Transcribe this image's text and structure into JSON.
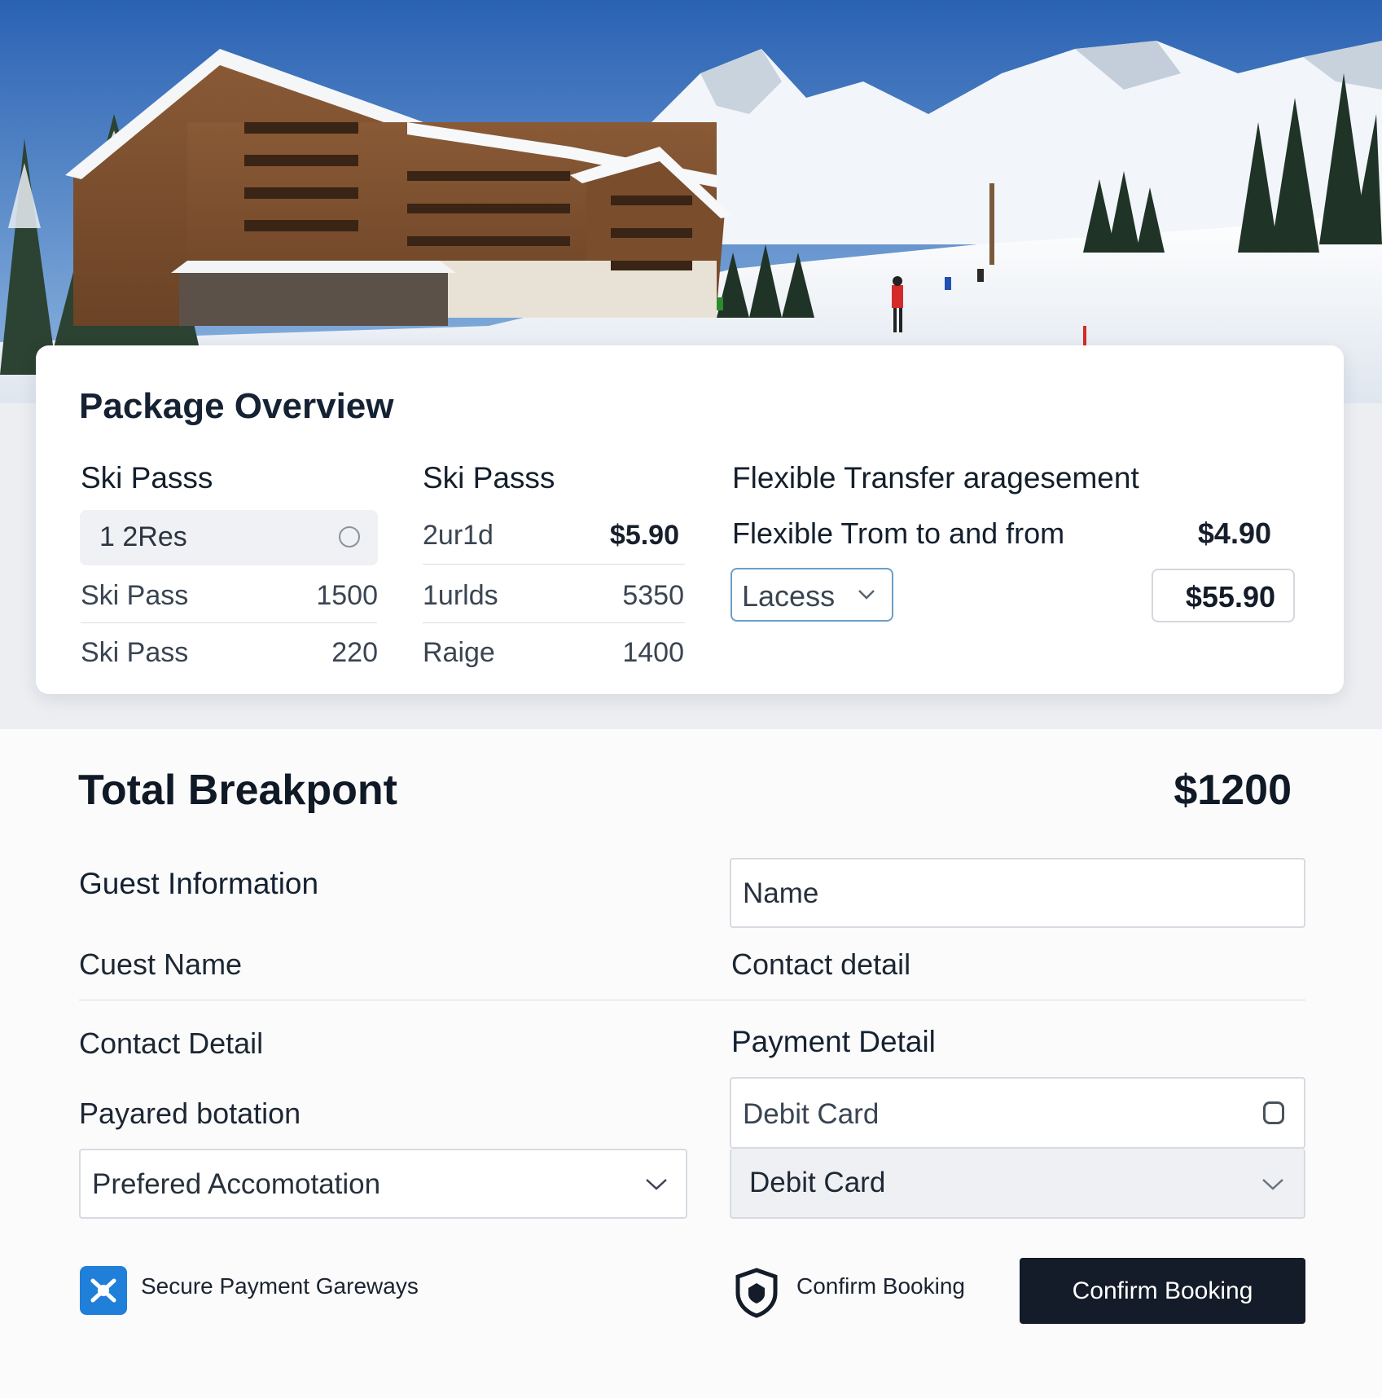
{
  "package": {
    "title": "Package Overview",
    "col1": {
      "heading": "Ski Passs",
      "selected": "1 2Res",
      "rows": [
        {
          "label": "Ski Pass",
          "value": "1500"
        },
        {
          "label": "Ski Pass",
          "value": "220"
        }
      ]
    },
    "col2": {
      "heading": "Ski Passs",
      "rows": [
        {
          "label": "2ur1d",
          "value": "$5.90"
        },
        {
          "label": "1urlds",
          "value": "5350"
        },
        {
          "label": "Raige",
          "value": "1400"
        }
      ]
    },
    "col3": {
      "heading": "Flexible Transfer aragesement",
      "line_label": "Flexible Trom to and from",
      "line_price": "$4.90",
      "select_value": "Lacess",
      "price_box": "$55.90"
    }
  },
  "total": {
    "title": "Total Breakpont",
    "amount": "$1200"
  },
  "guest": {
    "title": "Guest Information",
    "name_placeholder": "Name",
    "guest_name_label": "Cuest Name",
    "contact_detail_right": "Contact detail",
    "contact_detail_left": "Contact Detail",
    "payment_detail_label": "Payment Detail",
    "accommodation_label": "Payared botation",
    "accommodation_value": "Prefered Accomotation",
    "debit_card_field": "Debit Card",
    "debit_card_select": "Debit Card"
  },
  "footer": {
    "secure_text": "Secure Payment Gareways",
    "confirm_text": "Confirm Booking",
    "confirm_button": "Confirm Booking"
  },
  "icons": {
    "secure": "secure-payment-icon",
    "shield": "shield-icon",
    "chevron": "chevron-down-icon",
    "radio": "radio-icon"
  },
  "colors": {
    "accent_blue": "#1f7fd9",
    "button_dark": "#131c28",
    "select_border": "#6a9ec7"
  }
}
